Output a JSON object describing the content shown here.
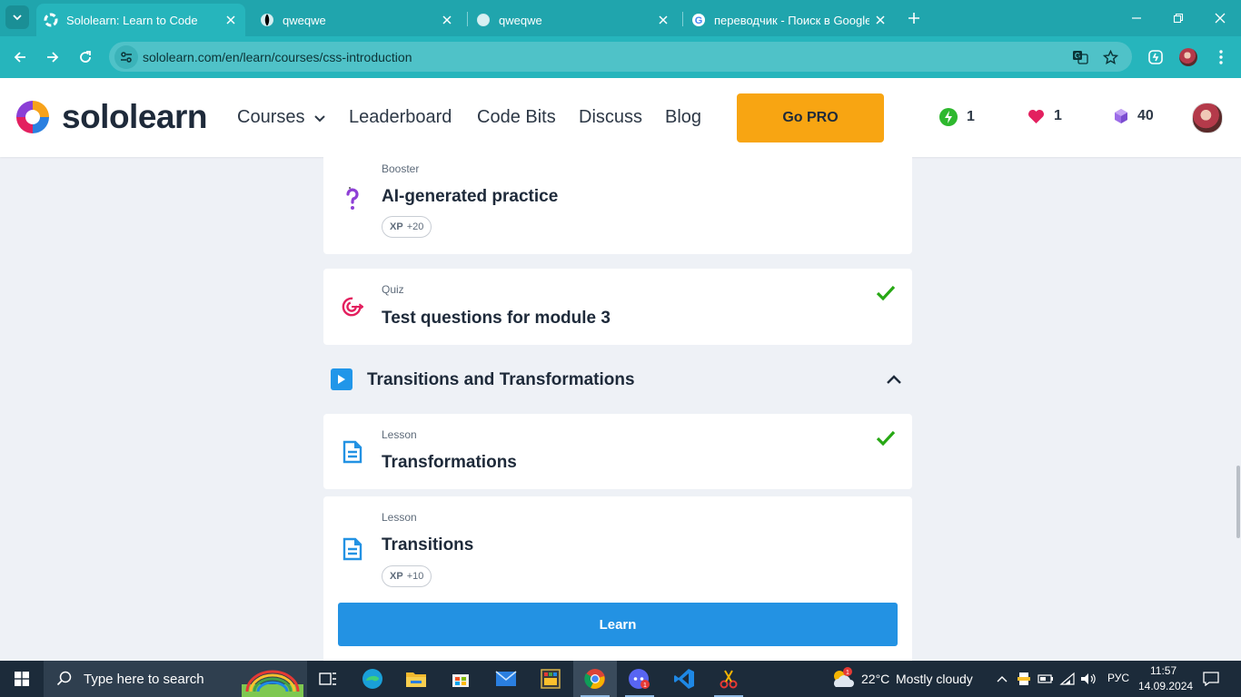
{
  "browser": {
    "tabs": [
      {
        "title": "Sololearn: Learn to Code",
        "active": true
      },
      {
        "title": "qweqwe",
        "active": false
      },
      {
        "title": "qweqwe",
        "active": false
      },
      {
        "title": "переводчик - Поиск в Google",
        "active": false
      }
    ],
    "url": "sololearn.com/en/learn/courses/css-introduction"
  },
  "site": {
    "logo_text": "sololearn",
    "nav": {
      "courses": "Courses",
      "leaderboard": "Leaderboard",
      "code_bits": "Code Bits",
      "discuss": "Discuss",
      "blog": "Blog"
    },
    "go_pro": "Go PRO",
    "stats": {
      "streak": "1",
      "hearts": "1",
      "gems": "40"
    }
  },
  "content": {
    "booster": {
      "kind": "Booster",
      "title": "AI-generated practice",
      "xp_label": "XP",
      "xp_value": "+20"
    },
    "quiz": {
      "kind": "Quiz",
      "title": "Test questions for module 3",
      "completed": true
    },
    "section": {
      "title": "Transitions and Transformations",
      "expanded": true
    },
    "lesson1": {
      "kind": "Lesson",
      "title": "Transformations",
      "completed": true
    },
    "lesson2": {
      "kind": "Lesson",
      "title": "Transitions",
      "xp_label": "XP",
      "xp_value": "+10"
    },
    "learn_button": "Learn"
  },
  "taskbar": {
    "search_placeholder": "Type here to search",
    "weather_temp": "22°C",
    "weather_desc": "Mostly cloudy",
    "language": "РУС",
    "time": "11:57",
    "date": "14.09.2024"
  },
  "colors": {
    "accent": "#26b5bc",
    "gopro": "#f8a512",
    "learn": "#2392e3",
    "check": "#27a814"
  }
}
